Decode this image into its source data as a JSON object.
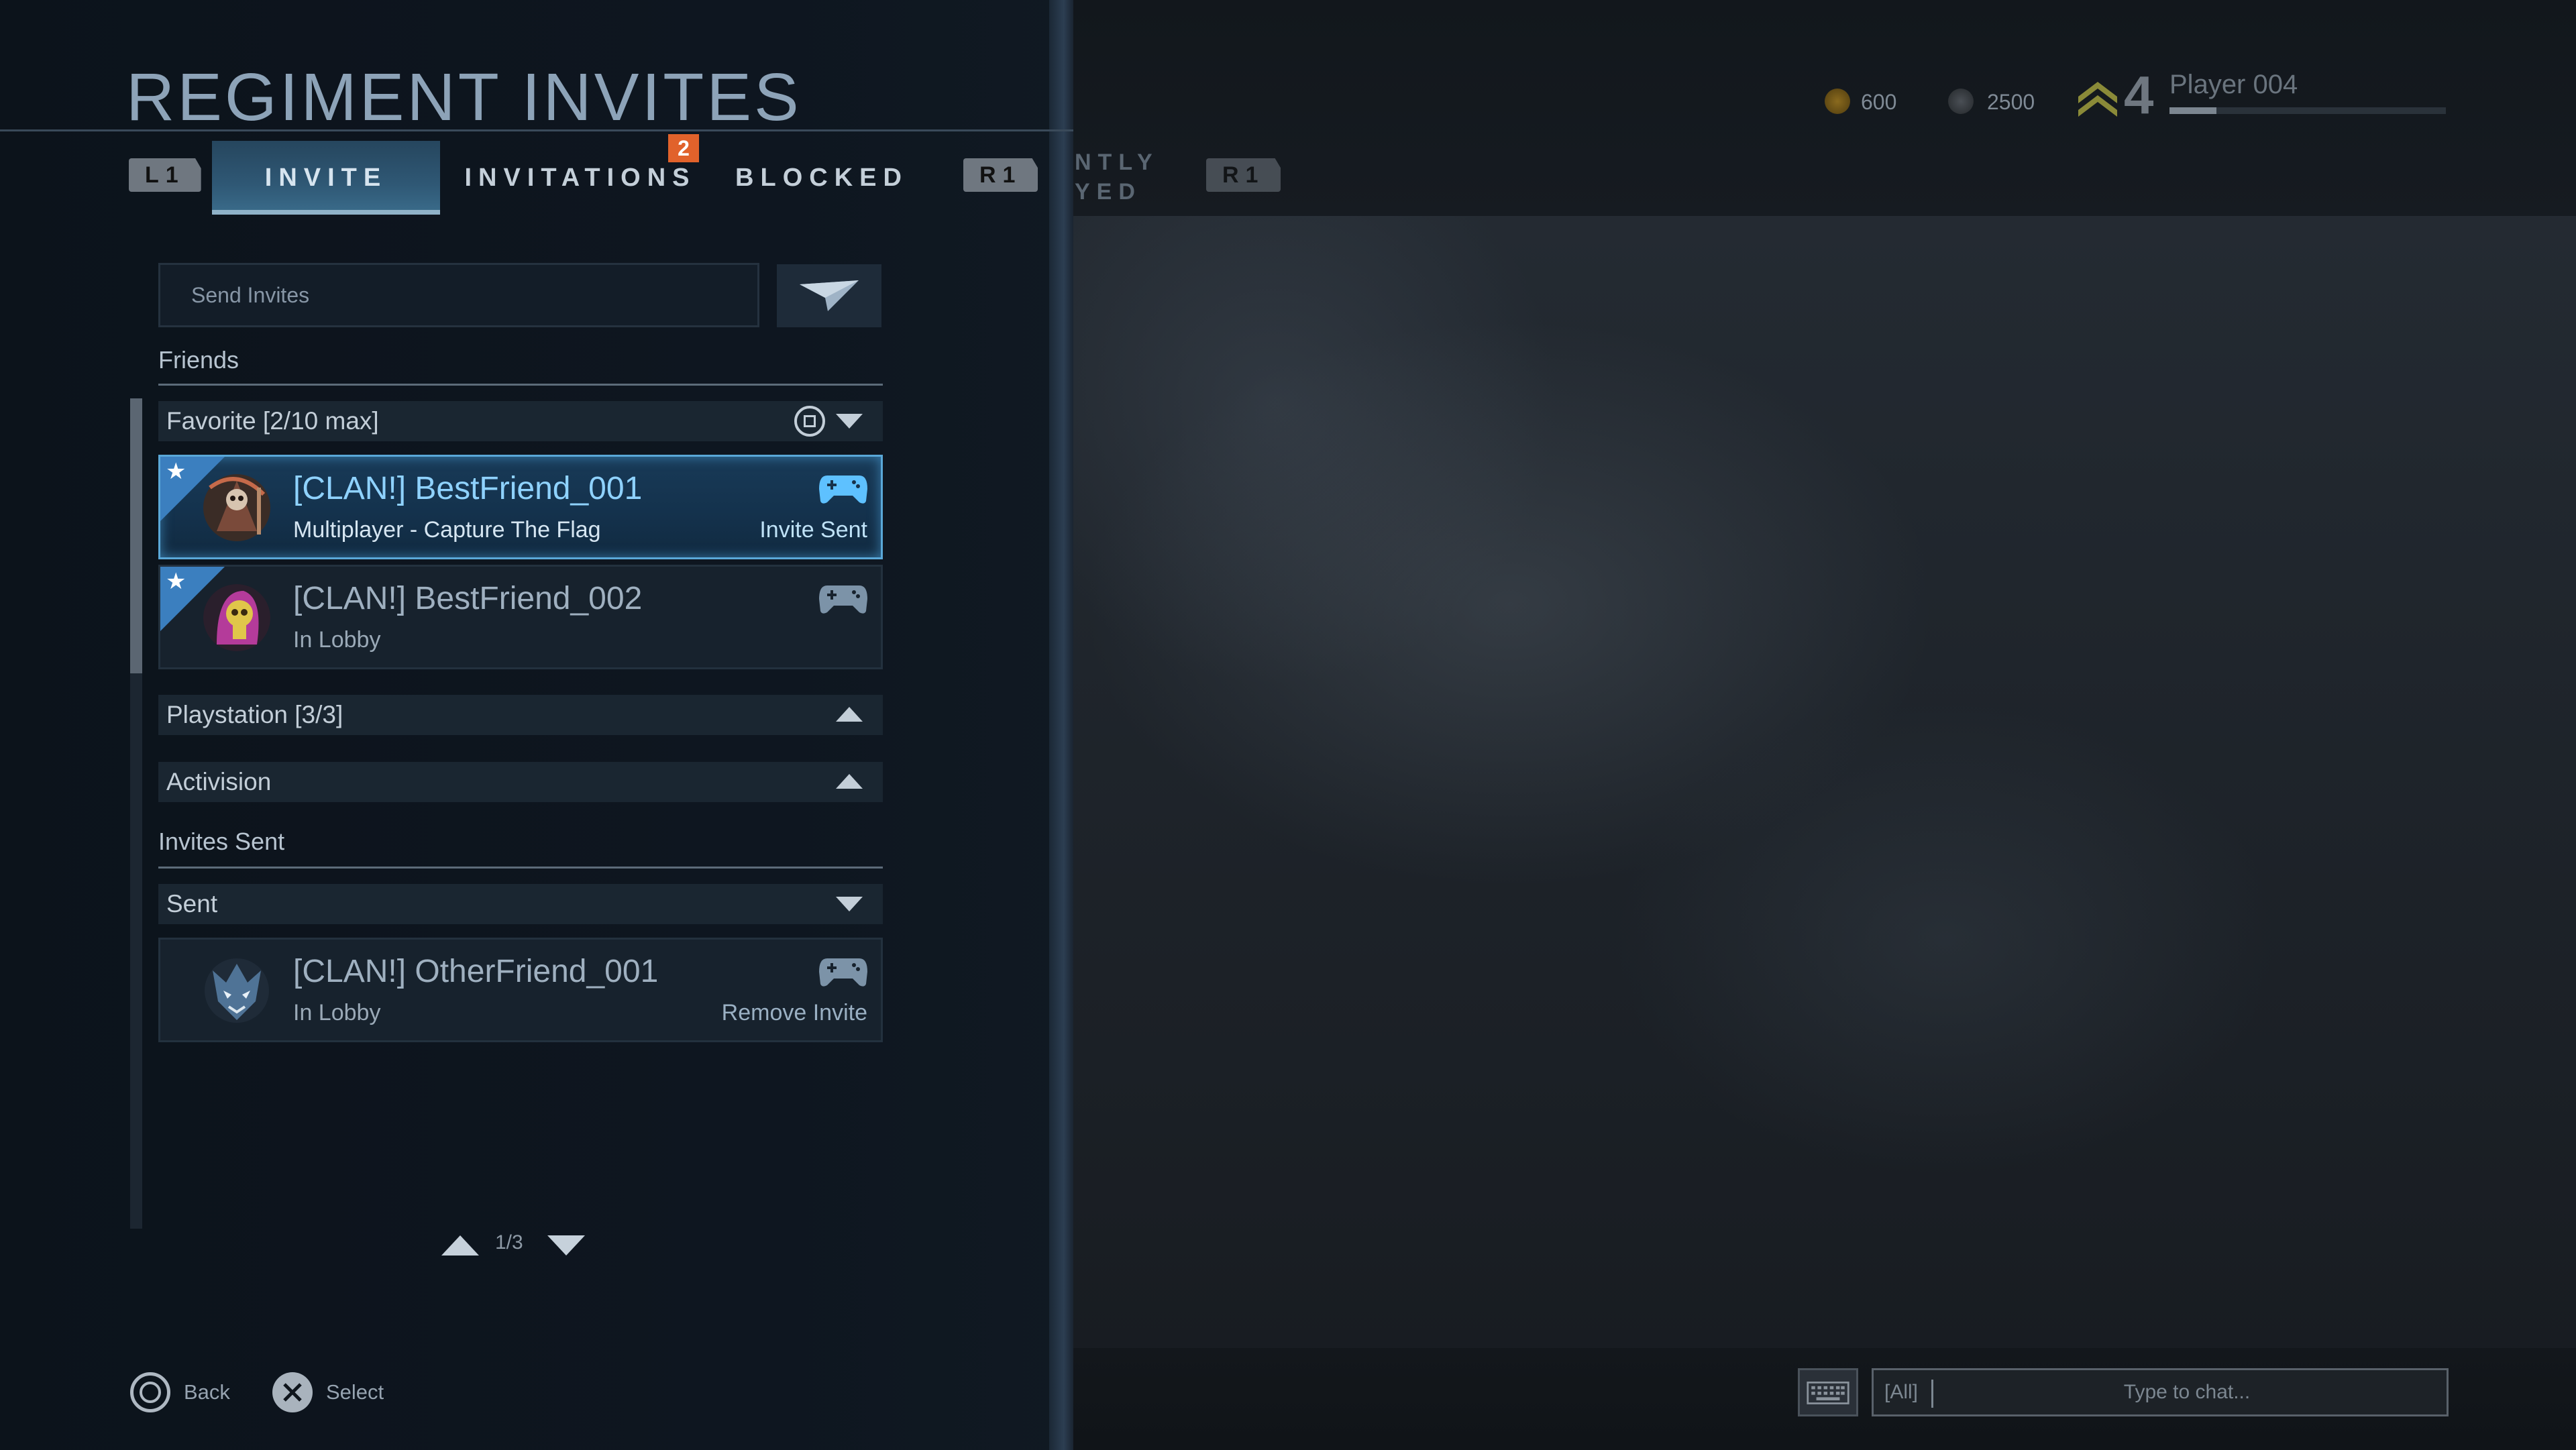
{
  "title": "REGIMENT INVITES",
  "tabs": {
    "left_bumper": "L1",
    "right_bumper": "R1",
    "right_bumper_faded": "R1",
    "items": [
      {
        "label": "INVITE"
      },
      {
        "label": "INVITATIONS"
      },
      {
        "label": "BLOCKED"
      }
    ],
    "invitations_badge": "2",
    "faded_tab_line1": "NTLY",
    "faded_tab_line2": "YED"
  },
  "send_invites": {
    "placeholder": "Send Invites"
  },
  "friends": {
    "section_label": "Friends",
    "favorite_group": {
      "label": "Favorite [2/10 max]",
      "items": [
        {
          "name": "[CLAN!] BestFriend_001",
          "status": "Multiplayer - Capture The Flag",
          "action": "Invite Sent"
        },
        {
          "name": "[CLAN!] BestFriend_002",
          "status": "In Lobby",
          "action": ""
        }
      ]
    },
    "playstation_group": {
      "label": "Playstation [3/3]"
    },
    "activision_group": {
      "label": "Activision"
    }
  },
  "invites_sent": {
    "section_label": "Invites Sent",
    "group": {
      "label": "Sent",
      "items": [
        {
          "name": "[CLAN!] OtherFriend_001",
          "status": "In Lobby",
          "action": "Remove Invite"
        }
      ]
    }
  },
  "pager": {
    "text": "1/3"
  },
  "footer": {
    "back_label": "Back",
    "select_label": "Select"
  },
  "header_status": {
    "cp_amount": "600",
    "xp_amount": "2500",
    "rank": "4",
    "player_name": "Player 004",
    "xp_progress": 0.17
  },
  "chat": {
    "prefix": "[All]",
    "placeholder": "Type to chat..."
  },
  "colors": {
    "accent_blue": "#5aa8d8",
    "badge_orange": "#e1622b",
    "favorite_blue": "#3b7fbf"
  }
}
